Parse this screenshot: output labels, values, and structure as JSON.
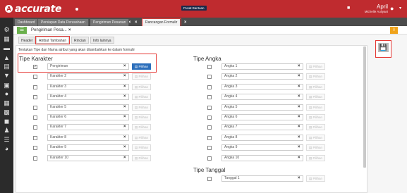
{
  "topbar": {
    "logo": "accurate",
    "logo_sub": "online",
    "pusat_bantuan": "Pusat Bantuan",
    "user_name": "April",
    "user_sub": "Michelle Auliyani"
  },
  "tabs": [
    "Dashboard",
    "Persiapan Data Perusahaan",
    "Pengiriman Pesanan",
    "Rancangan Formulir"
  ],
  "doc": {
    "title": "Pengiriman Pesa..."
  },
  "subtabs": [
    "Header",
    "Atribut Tambahan",
    "Rincian",
    "Info lainnya"
  ],
  "instruction": "Tentukan Tipe dan Nama atribut yang akan ditambahkan ke dalam formulir",
  "sections": {
    "karakter": "Tipe Karakter",
    "angka": "Tipe Angka",
    "tanggal": "Tipe Tanggal"
  },
  "pilih_label": "Pilihan",
  "karakter": [
    {
      "value": "Pengiriman",
      "checked": true
    },
    {
      "value": "Karakter 2",
      "checked": false
    },
    {
      "value": "Karakter 3",
      "checked": false
    },
    {
      "value": "Karakter 4",
      "checked": false
    },
    {
      "value": "Karakter 5",
      "checked": false
    },
    {
      "value": "Karakter 6",
      "checked": false
    },
    {
      "value": "Karakter 7",
      "checked": false
    },
    {
      "value": "Karakter 8",
      "checked": false
    },
    {
      "value": "Karakter 9",
      "checked": false
    },
    {
      "value": "Karakter 10",
      "checked": false
    }
  ],
  "angka": [
    "Angka 1",
    "Angka 2",
    "Angka 3",
    "Angka 4",
    "Angka 5",
    "Angka 6",
    "Angka 7",
    "Angka 8",
    "Angka 9",
    "Angka 10"
  ],
  "tanggal": [
    "Tanggal 1"
  ],
  "colors": {
    "brand_red": "#bf2b2f",
    "highlight": "#e53935",
    "pilih_blue": "#2c6fbb",
    "list_green": "#6ab04c",
    "orange": "#f0a31a"
  }
}
